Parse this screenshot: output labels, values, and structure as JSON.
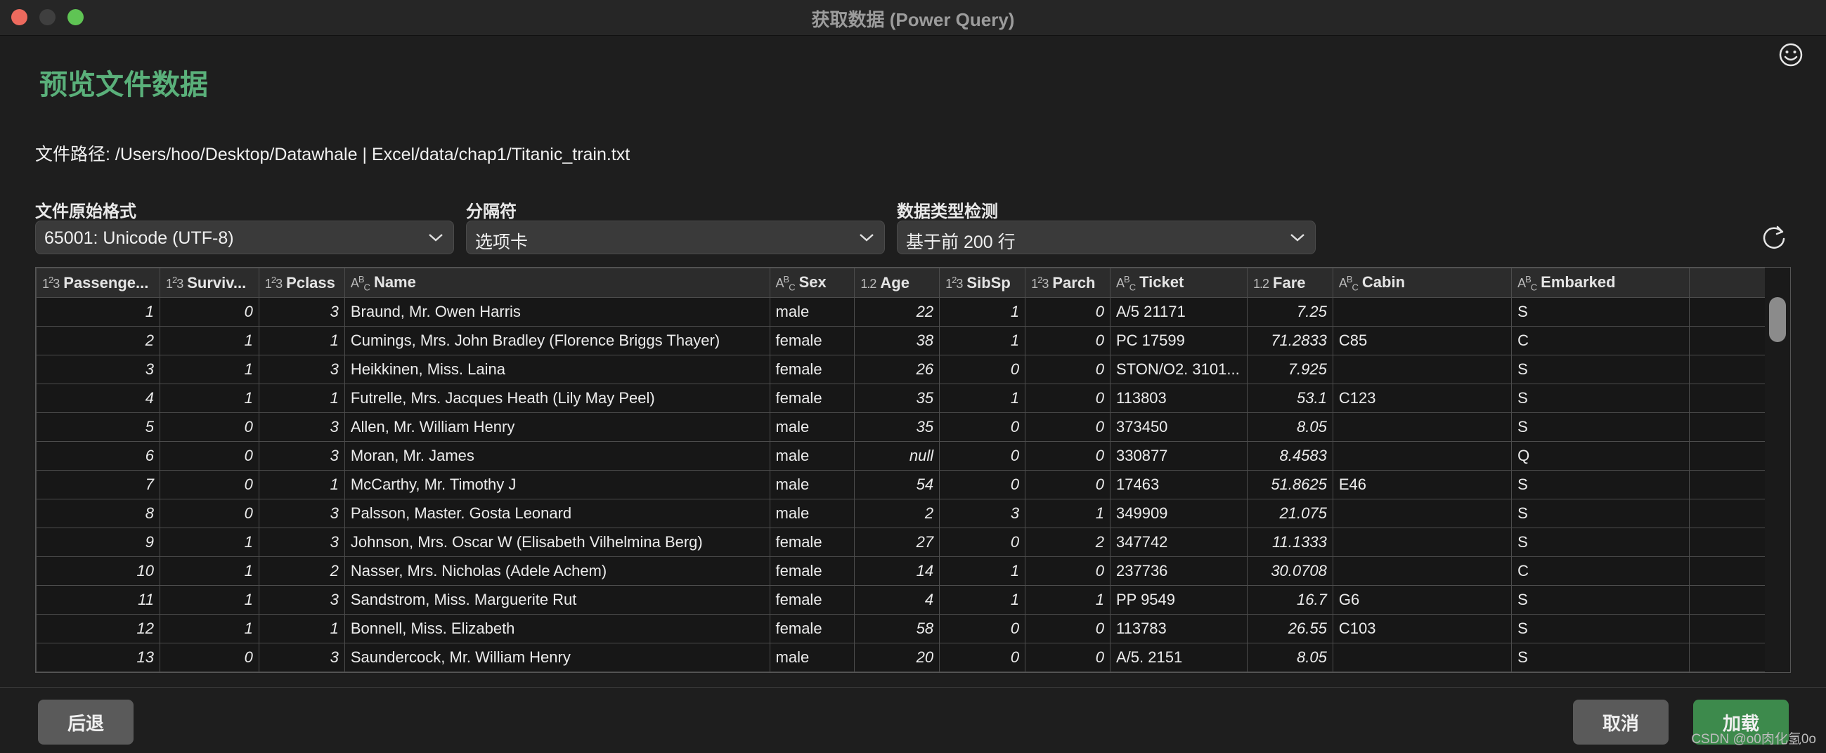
{
  "window": {
    "title": "获取数据 (Power Query)"
  },
  "page_title": "预览文件数据",
  "file_path": "文件路径: /Users/hoo/Desktop/Datawhale  |  Excel/data/chap1/Titanic_train.txt",
  "fields": {
    "encoding": {
      "label": "文件原始格式",
      "value": "65001: Unicode (UTF-8)"
    },
    "delimiter": {
      "label": "分隔符",
      "value": "选项卡"
    },
    "type_detection": {
      "label": "数据类型检测",
      "value": "基于前 200 行"
    }
  },
  "table": {
    "columns": [
      {
        "type": "int",
        "label": "PassengerId",
        "display": "Passenge..."
      },
      {
        "type": "int",
        "label": "Survived",
        "display": "Surviv..."
      },
      {
        "type": "int",
        "label": "Pclass",
        "display": "Pclass"
      },
      {
        "type": "text",
        "label": "Name",
        "display": "Name"
      },
      {
        "type": "text",
        "label": "Sex",
        "display": "Sex"
      },
      {
        "type": "decimal",
        "label": "Age",
        "display": "Age"
      },
      {
        "type": "int",
        "label": "SibSp",
        "display": "SibSp"
      },
      {
        "type": "int",
        "label": "Parch",
        "display": "Parch"
      },
      {
        "type": "text",
        "label": "Ticket",
        "display": "Ticket"
      },
      {
        "type": "decimal",
        "label": "Fare",
        "display": "Fare"
      },
      {
        "type": "text",
        "label": "Cabin",
        "display": "Cabin"
      },
      {
        "type": "text",
        "label": "Embarked",
        "display": "Embarked"
      }
    ],
    "rows": [
      [
        "1",
        "0",
        "3",
        "Braund, Mr. Owen Harris",
        "male",
        "22",
        "1",
        "0",
        "A/5 21171",
        "7.25",
        "",
        "S"
      ],
      [
        "2",
        "1",
        "1",
        "Cumings, Mrs. John Bradley (Florence Briggs Thayer)",
        "female",
        "38",
        "1",
        "0",
        "PC 17599",
        "71.2833",
        "C85",
        "C"
      ],
      [
        "3",
        "1",
        "3",
        "Heikkinen, Miss. Laina",
        "female",
        "26",
        "0",
        "0",
        "STON/O2. 3101...",
        "7.925",
        "",
        "S"
      ],
      [
        "4",
        "1",
        "1",
        "Futrelle, Mrs. Jacques Heath (Lily May Peel)",
        "female",
        "35",
        "1",
        "0",
        "113803",
        "53.1",
        "C123",
        "S"
      ],
      [
        "5",
        "0",
        "3",
        "Allen, Mr. William Henry",
        "male",
        "35",
        "0",
        "0",
        "373450",
        "8.05",
        "",
        "S"
      ],
      [
        "6",
        "0",
        "3",
        "Moran, Mr. James",
        "male",
        "null",
        "0",
        "0",
        "330877",
        "8.4583",
        "",
        "Q"
      ],
      [
        "7",
        "0",
        "1",
        "McCarthy, Mr. Timothy J",
        "male",
        "54",
        "0",
        "0",
        "17463",
        "51.8625",
        "E46",
        "S"
      ],
      [
        "8",
        "0",
        "3",
        "Palsson, Master. Gosta Leonard",
        "male",
        "2",
        "3",
        "1",
        "349909",
        "21.075",
        "",
        "S"
      ],
      [
        "9",
        "1",
        "3",
        "Johnson, Mrs. Oscar W (Elisabeth Vilhelmina Berg)",
        "female",
        "27",
        "0",
        "2",
        "347742",
        "11.1333",
        "",
        "S"
      ],
      [
        "10",
        "1",
        "2",
        "Nasser, Mrs. Nicholas (Adele Achem)",
        "female",
        "14",
        "1",
        "0",
        "237736",
        "30.0708",
        "",
        "C"
      ],
      [
        "11",
        "1",
        "3",
        "Sandstrom, Miss. Marguerite Rut",
        "female",
        "4",
        "1",
        "1",
        "PP 9549",
        "16.7",
        "G6",
        "S"
      ],
      [
        "12",
        "1",
        "1",
        "Bonnell, Miss. Elizabeth",
        "female",
        "58",
        "0",
        "0",
        "113783",
        "26.55",
        "C103",
        "S"
      ],
      [
        "13",
        "0",
        "3",
        "Saundercock, Mr. William Henry",
        "male",
        "20",
        "0",
        "0",
        "A/5. 2151",
        "8.05",
        "",
        "S"
      ]
    ]
  },
  "buttons": {
    "back": "后退",
    "cancel": "取消",
    "load": "加载"
  },
  "watermark": "CSDN @o0肉化氢0o",
  "colors": {
    "accent_green": "#5ab07a",
    "load_button": "#3d8a4c",
    "background": "#1e1e1e"
  },
  "icons": [
    "smiley-icon",
    "chevron-down-icon",
    "refresh-icon",
    "integer-type-icon",
    "text-type-icon",
    "decimal-type-icon"
  ]
}
